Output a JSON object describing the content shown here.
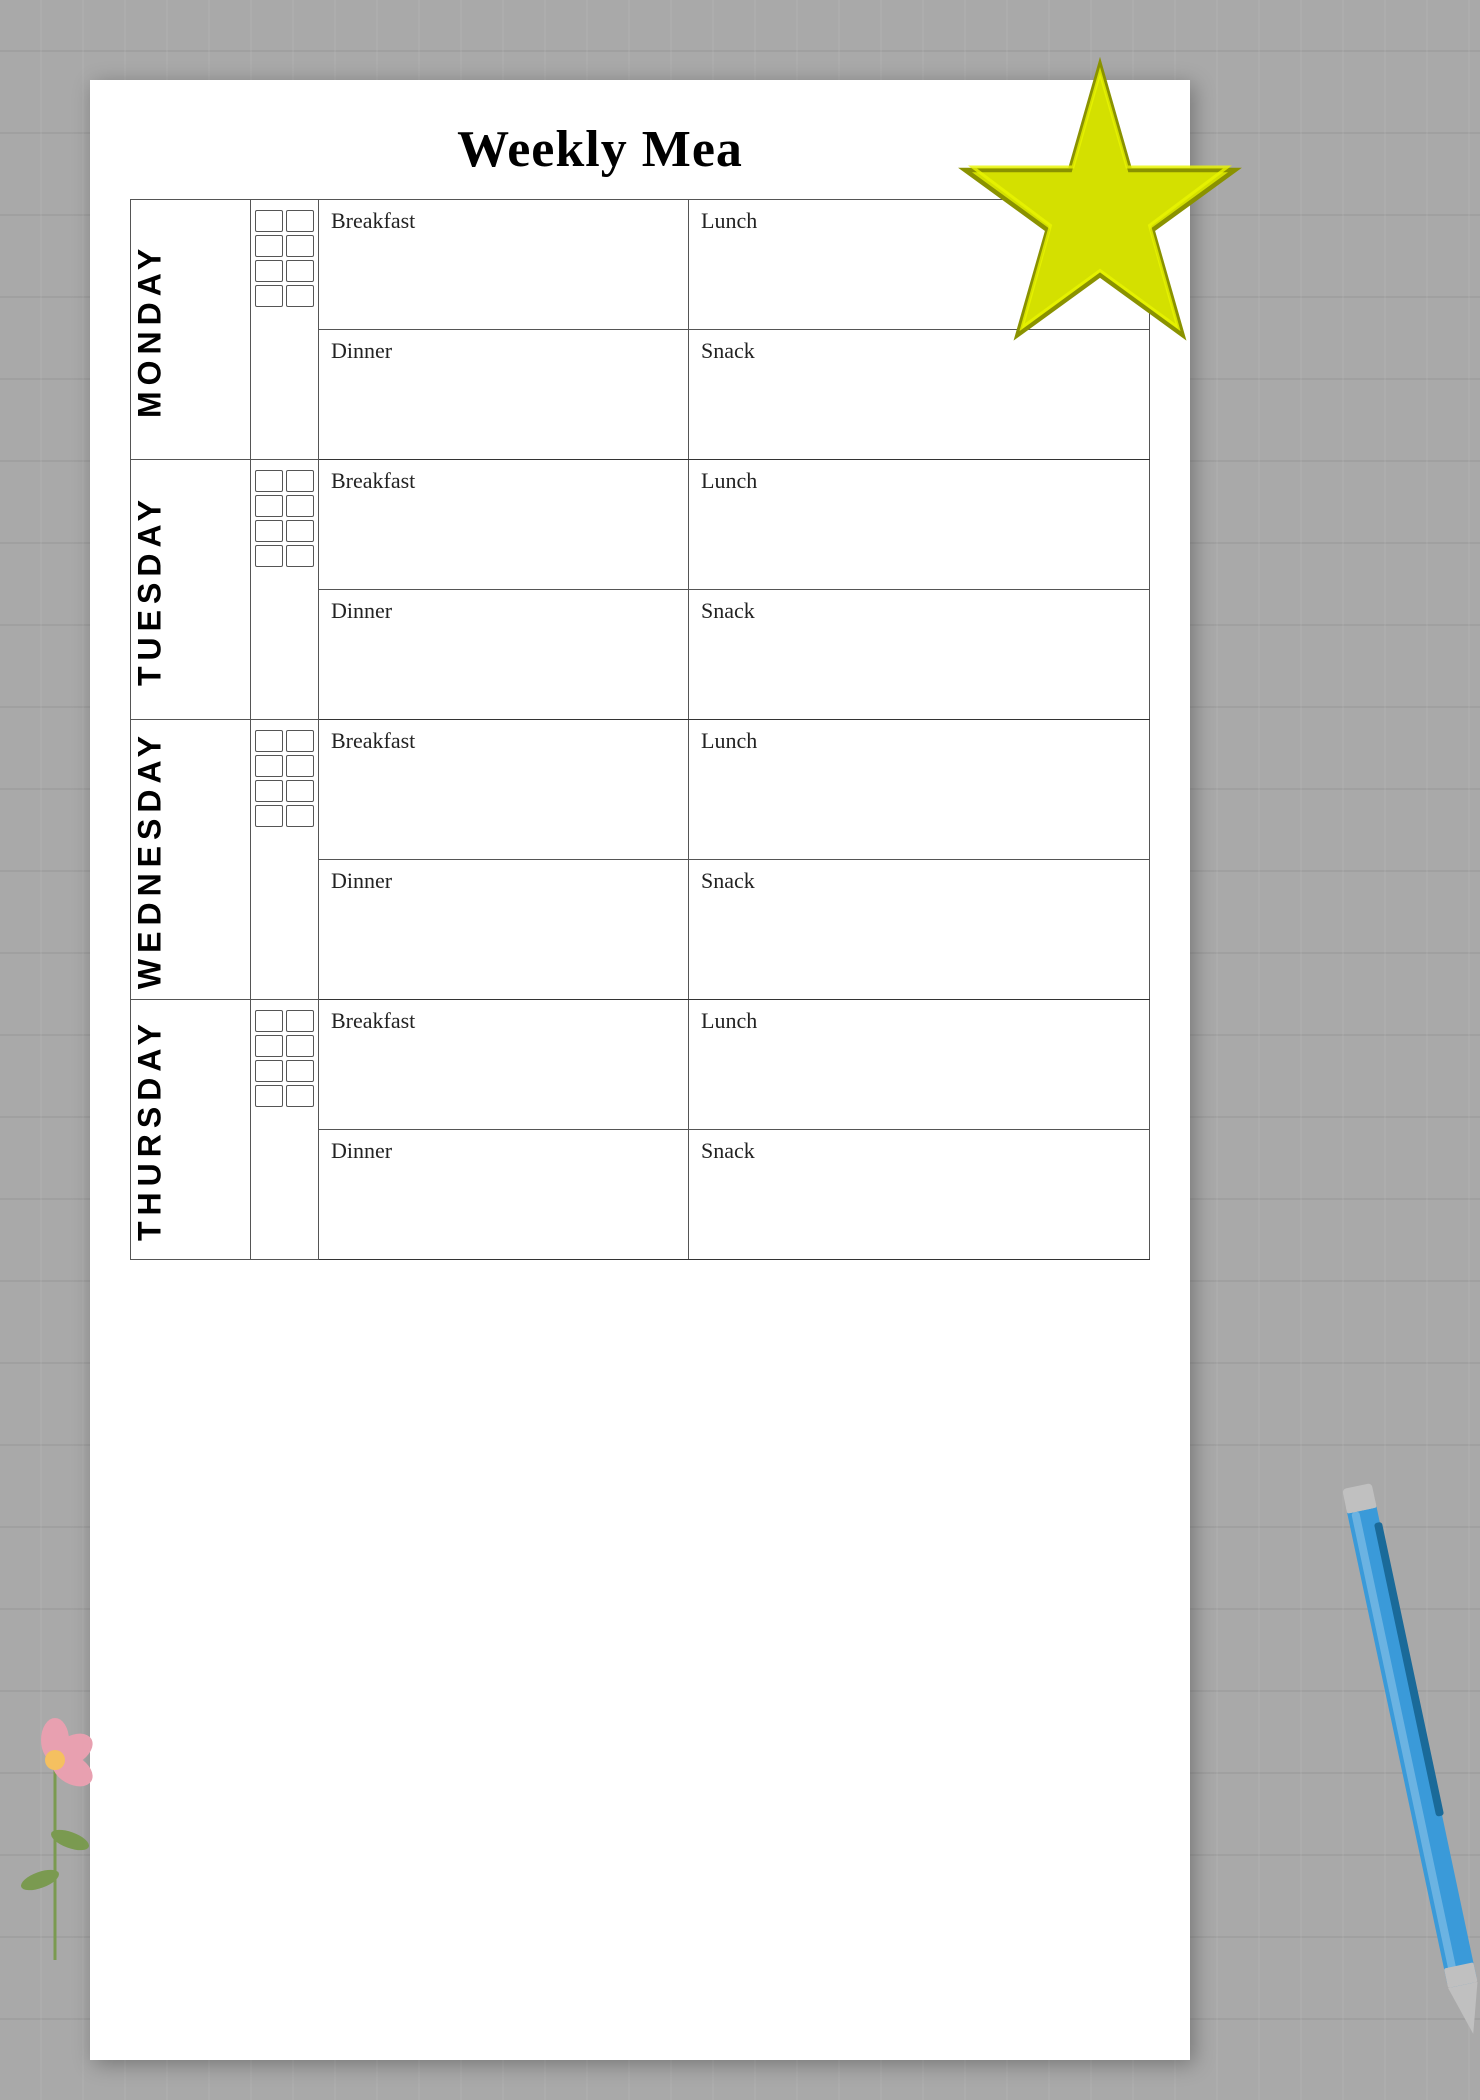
{
  "page": {
    "title": "Weekly Mea",
    "background_color": "#a9a9a9"
  },
  "days": [
    {
      "name": "MONDAY",
      "meals": [
        {
          "top_left": "Breakfast",
          "top_right": "Lunch"
        },
        {
          "bottom_left": "Dinner",
          "bottom_right": "Snack"
        }
      ]
    },
    {
      "name": "TUESDAY",
      "meals": [
        {
          "top_left": "Breakfast",
          "top_right": "Lunch"
        },
        {
          "bottom_left": "Dinner",
          "bottom_right": "Snack"
        }
      ]
    },
    {
      "name": "WEDNESDAY",
      "meals": [
        {
          "top_left": "Breakfast",
          "top_right": "Lunch"
        },
        {
          "bottom_left": "Dinner",
          "bottom_right": "Snack"
        }
      ]
    },
    {
      "name": "THURSDAY",
      "meals": [
        {
          "top_left": "Breakfast",
          "top_right": "Lunch"
        },
        {
          "bottom_left": "Dinner",
          "bottom_right": "Snack"
        }
      ]
    }
  ],
  "checkbox_count": 8
}
